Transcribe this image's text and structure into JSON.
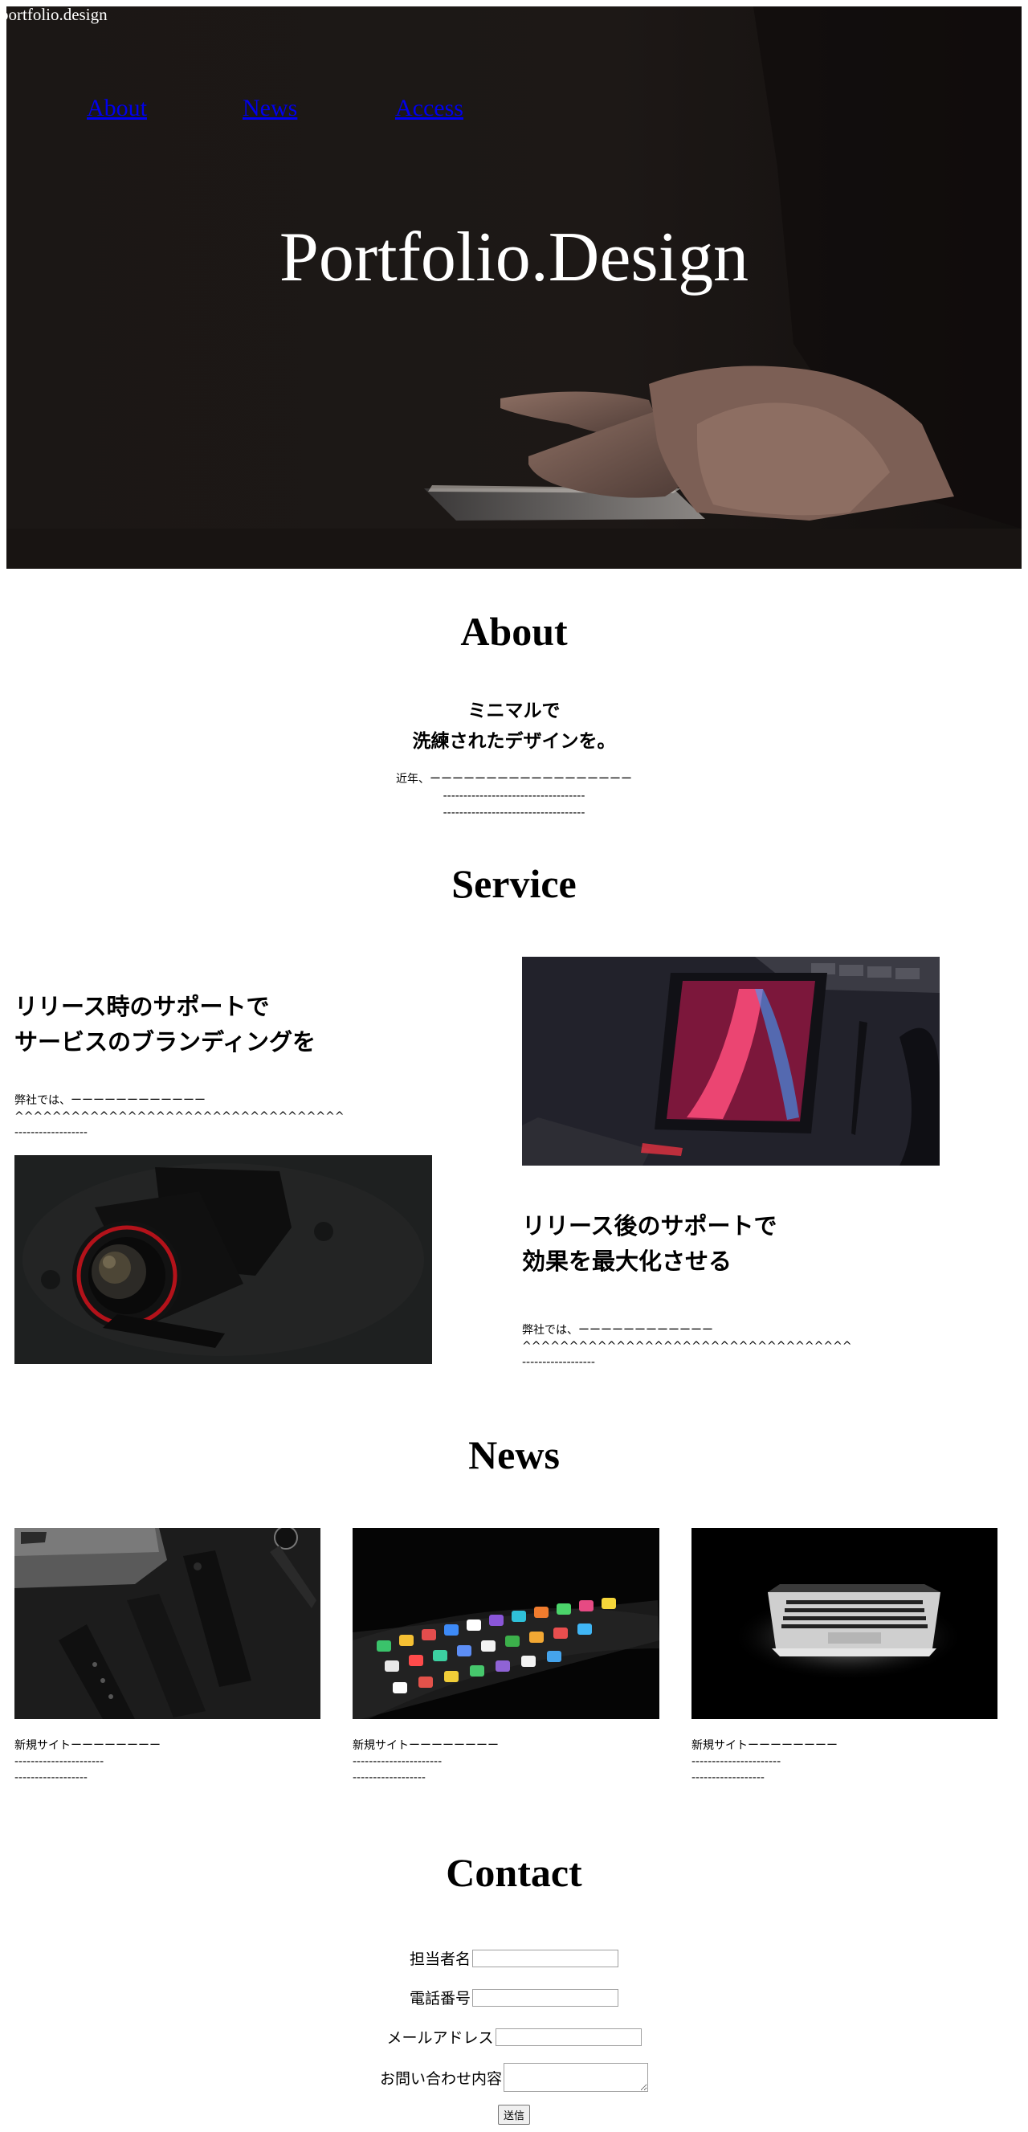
{
  "header": {
    "logo": "portfolio.design",
    "nav": [
      {
        "label": "About"
      },
      {
        "label": "News"
      },
      {
        "label": "Access"
      }
    ],
    "title": "Portfolio.Design"
  },
  "about": {
    "heading": "About",
    "lead_line1": "ミニマルで",
    "lead_line2": "洗練されたデザインを。",
    "text_line1": "近年、ーーーーーーーーーーーーーーーーーー",
    "text_line2": "-----------------------------------",
    "text_line3": "-----------------------------------"
  },
  "service": {
    "heading": "Service",
    "item1": {
      "heading_line1": "リリース時のサポートで",
      "heading_line2": "サービスのブランディングを",
      "text_line1": "弊社では、ーーーーーーーーーーーー",
      "text_line2": "^^^^^^^^^^^^^^^^^^^^^^^^^^^^^^^^^^^",
      "text_line3": "------------------"
    },
    "item2": {
      "heading_line1": "リリース後のサポートで",
      "heading_line2": "効果を最大化させる",
      "text_line1": "弊社では、ーーーーーーーーーーーー",
      "text_line2": "^^^^^^^^^^^^^^^^^^^^^^^^^^^^^^^^^^^",
      "text_line3": "------------------"
    }
  },
  "news": {
    "heading": "News",
    "items": [
      {
        "line1": "新規サイトーーーーーーーー",
        "line2": "----------------------",
        "line3": "------------------"
      },
      {
        "line1": "新規サイトーーーーーーーー",
        "line2": "----------------------",
        "line3": "------------------"
      },
      {
        "line1": "新規サイトーーーーーーーー",
        "line2": "----------------------",
        "line3": "------------------"
      }
    ]
  },
  "contact": {
    "heading": "Contact",
    "name_label": "担当者名",
    "phone_label": "電話番号",
    "email_label": "メールアドレス",
    "message_label": "お問い合わせ内容",
    "submit_label": "送信"
  },
  "colors": {
    "hero_bg": "#1a1614",
    "link": "#0000ee",
    "text": "#000000"
  }
}
